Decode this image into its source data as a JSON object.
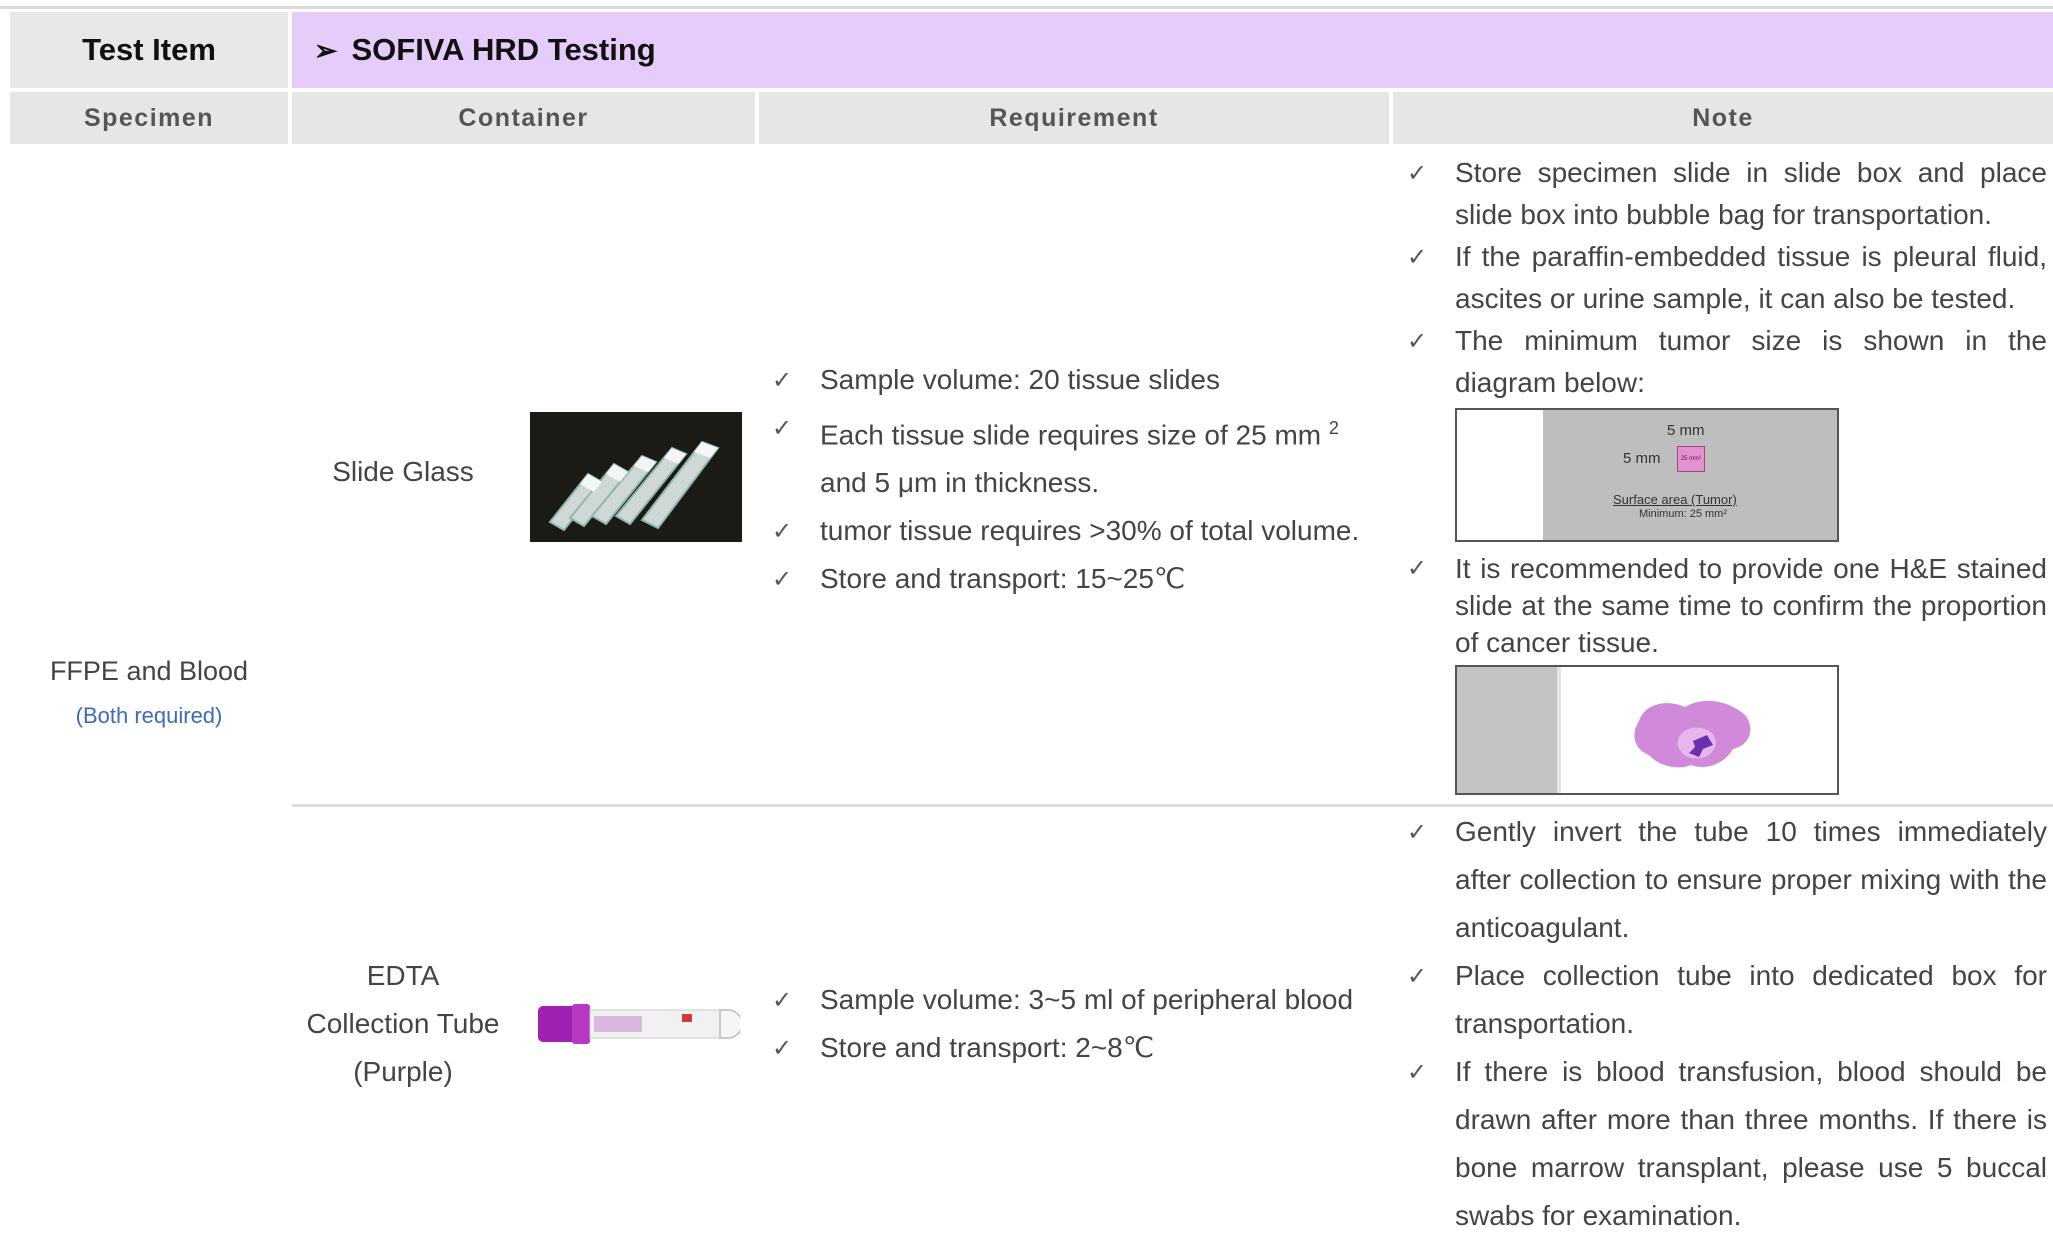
{
  "header": {
    "test_item_label": "Test Item",
    "arrow_glyph": "➢",
    "test_name": "SOFIVA HRD Testing"
  },
  "columns": {
    "specimen": "Specimen",
    "container": "Container",
    "requirement": "Requirement",
    "note": "Note"
  },
  "specimen": {
    "label": "FFPE and Blood",
    "sub_label": "(Both required)"
  },
  "check_glyph": "✓",
  "rows": [
    {
      "container": "Slide Glass",
      "requirements": [
        "Sample volume: 20 tissue slides",
        {
          "before": "Each tissue slide requires size of 25 mm ",
          "sup": "2",
          "after": " and 5 μm in thickness."
        },
        "tumor tissue requires >30% of total volume.",
        "Store and transport: 15~25℃"
      ],
      "notes": [
        "Store specimen slide in slide box and place slide box into bubble bag for transportation.",
        "If the paraffin-embedded tissue is pleural fluid, ascites or urine sample, it can also be tested.",
        "The minimum tumor size is shown in the diagram below:",
        "It is recommended to provide one H&E stained slide at the same time to confirm the proportion of cancer tissue."
      ],
      "tumor_diagram": {
        "side_top": "5 mm",
        "side_left": "5 mm",
        "square_label": "25 mm²",
        "caption": "Surface area (Tumor)",
        "minimum": "Minimum: 25 mm²"
      }
    },
    {
      "container": [
        "EDTA",
        "Collection Tube",
        "(Purple)"
      ],
      "requirements": [
        "Sample volume: 3~5 ml of peripheral blood",
        "Store and transport: 2~8℃"
      ],
      "notes": [
        "Gently invert the tube 10 times immediately after collection to ensure proper mixing with the anticoagulant.",
        "Place collection tube into dedicated box for transportation.",
        "If there is blood transfusion, blood should be drawn after more than three months. If there is bone marrow transplant, please use 5 buccal swabs for examination."
      ]
    }
  ],
  "colors": {
    "title_band": "#e6ccfa",
    "header_gray": "#e6e6e6",
    "sub_label_blue": "#3d6bb8",
    "tube_cap_purple": "#a020b0",
    "tissue_pink": "#cf86d6",
    "tumor_purple": "#6b2fb0"
  }
}
